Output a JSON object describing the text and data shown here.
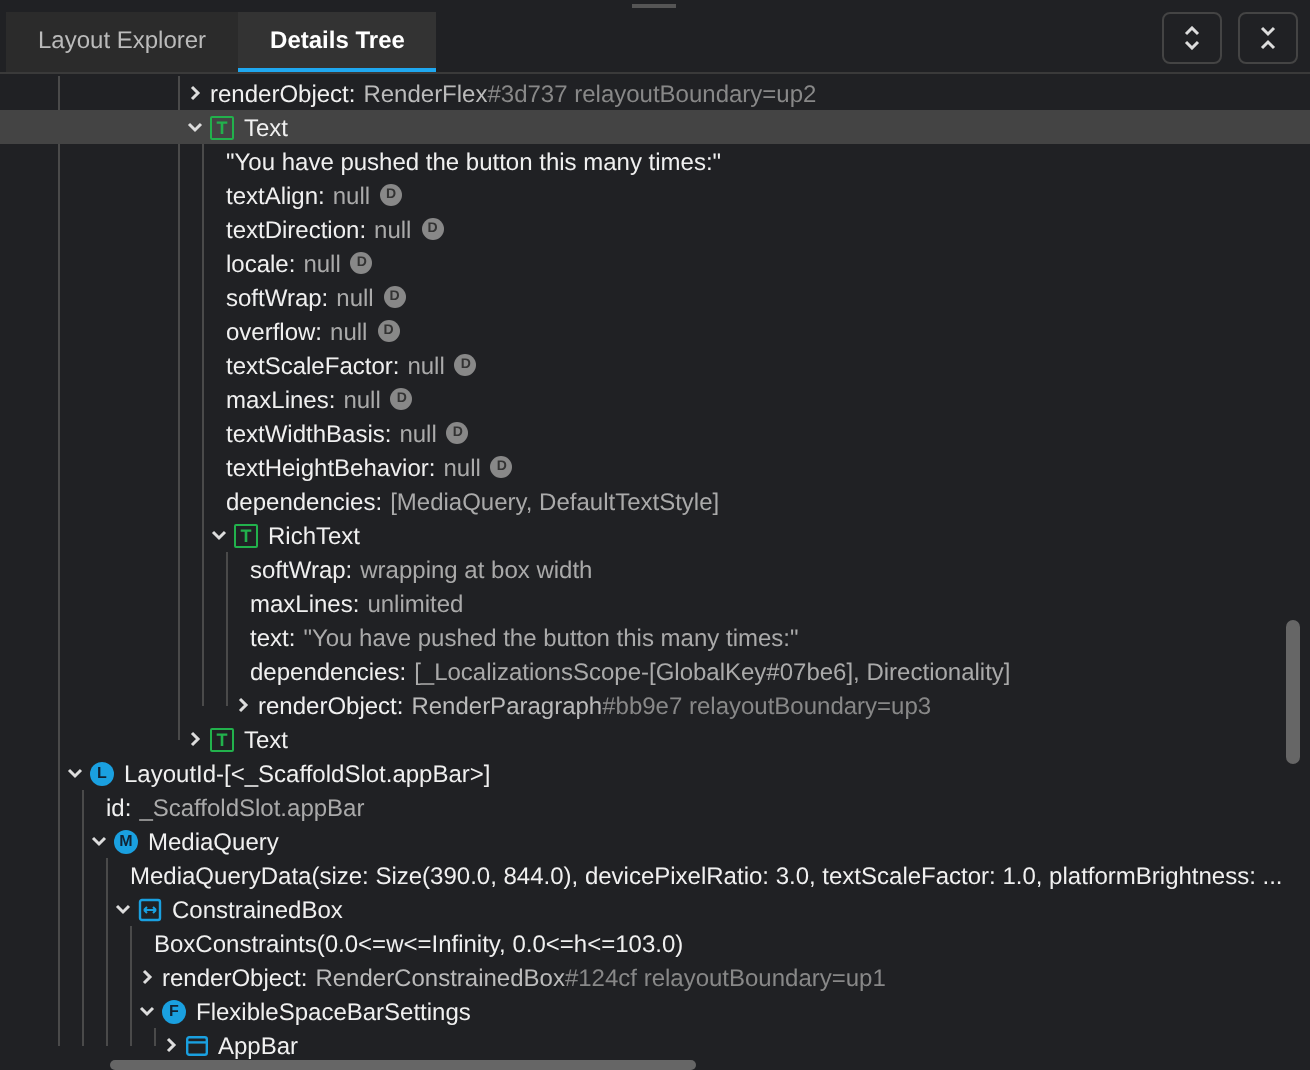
{
  "tabs": [
    {
      "label": "Layout Explorer",
      "selected": false
    },
    {
      "label": "Details Tree",
      "selected": true
    }
  ],
  "toolbar": [
    {
      "kind": "expand-all"
    },
    {
      "kind": "collapse-all"
    }
  ],
  "tree": [
    {
      "children": [
        {
          "children": [
            {
              "children": [
                {
                  "children": [
                    {
                      "children": [
                        {
                          "children": [
                            {
                              "name": "renderObject:",
                              "value": "RenderFlex",
                              "detail": "#3d737 relayoutBoundary=up2",
                              "expanded": false,
                              "selected": false
                            },
                            {
                              "name": "Text",
                              "kind": "square",
                              "letter": "T",
                              "expanded": true,
                              "selected": true,
                              "children": [
                                {
                                  "name": "\"You have pushed the button this many times:\"",
                                  "selected": false
                                },
                                {
                                  "name": "textAlign:",
                                  "value": "null",
                                  "badge": "D",
                                  "selected": false
                                },
                                {
                                  "name": "textDirection:",
                                  "value": "null",
                                  "badge": "D",
                                  "selected": false
                                },
                                {
                                  "name": "locale:",
                                  "value": "null",
                                  "badge": "D",
                                  "selected": false
                                },
                                {
                                  "name": "softWrap:",
                                  "value": "null",
                                  "badge": "D",
                                  "selected": false
                                },
                                {
                                  "name": "overflow:",
                                  "value": "null",
                                  "badge": "D",
                                  "selected": false
                                },
                                {
                                  "name": "textScaleFactor:",
                                  "value": "null",
                                  "badge": "D",
                                  "selected": false
                                },
                                {
                                  "name": "maxLines:",
                                  "value": "null",
                                  "badge": "D",
                                  "selected": false
                                },
                                {
                                  "name": "textWidthBasis:",
                                  "value": "null",
                                  "badge": "D",
                                  "selected": false
                                },
                                {
                                  "name": "textHeightBehavior:",
                                  "value": "null",
                                  "badge": "D",
                                  "selected": false
                                },
                                {
                                  "name": "dependencies:",
                                  "value": "[MediaQuery, DefaultTextStyle]",
                                  "selected": false
                                },
                                {
                                  "name": "RichText",
                                  "kind": "square",
                                  "letter": "T",
                                  "expanded": true,
                                  "selected": false,
                                  "children": [
                                    {
                                      "name": "softWrap:",
                                      "value": "wrapping at box width",
                                      "selected": false
                                    },
                                    {
                                      "name": "maxLines:",
                                      "value": "unlimited",
                                      "selected": false
                                    },
                                    {
                                      "name": "text:",
                                      "value": "\"You have pushed the button this many times:\"",
                                      "selected": false
                                    },
                                    {
                                      "name": "dependencies:",
                                      "value": "[_LocalizationsScope-[GlobalKey#07be6], Directionality]",
                                      "selected": false
                                    },
                                    {
                                      "name": "renderObject:",
                                      "value": "RenderParagraph",
                                      "detail": "#bb9e7 relayoutBoundary=up3",
                                      "expanded": false,
                                      "selected": false
                                    }
                                  ]
                                }
                              ]
                            },
                            {
                              "name": "Text",
                              "kind": "square",
                              "letter": "T",
                              "expanded": false,
                              "selected": false
                            }
                          ]
                        }
                      ]
                    }
                  ]
                }
              ]
            }
          ]
        },
        {
          "name": "LayoutId-[<_ScaffoldSlot.appBar>]",
          "kind": "circle",
          "letter": "L",
          "expanded": true,
          "selected": false,
          "children": [
            {
              "name": "id:",
              "value": "_ScaffoldSlot.appBar",
              "selected": false
            },
            {
              "name": "MediaQuery",
              "kind": "circle",
              "letter": "M",
              "expanded": true,
              "selected": false,
              "children": [
                {
                  "name": "MediaQueryData(size: Size(390.0, 844.0), devicePixelRatio: 3.0, textScaleFactor: 1.0, platformBrightness: ...",
                  "selected": false
                },
                {
                  "name": "ConstrainedBox",
                  "kind": "constrained",
                  "expanded": true,
                  "selected": false,
                  "children": [
                    {
                      "name": "BoxConstraints(0.0<=w<=Infinity, 0.0<=h<=103.0)",
                      "selected": false
                    },
                    {
                      "name": "renderObject:",
                      "value": "RenderConstrainedBox",
                      "detail": "#124cf relayoutBoundary=up1",
                      "expanded": false,
                      "selected": false
                    },
                    {
                      "name": "FlexibleSpaceBarSettings",
                      "kind": "circle",
                      "letter": "F",
                      "expanded": true,
                      "selected": false,
                      "children": [
                        {
                          "name": "AppBar",
                          "kind": "appbar",
                          "expanded": false,
                          "selected": false
                        }
                      ]
                    }
                  ]
                }
              ]
            }
          ]
        }
      ]
    }
  ]
}
